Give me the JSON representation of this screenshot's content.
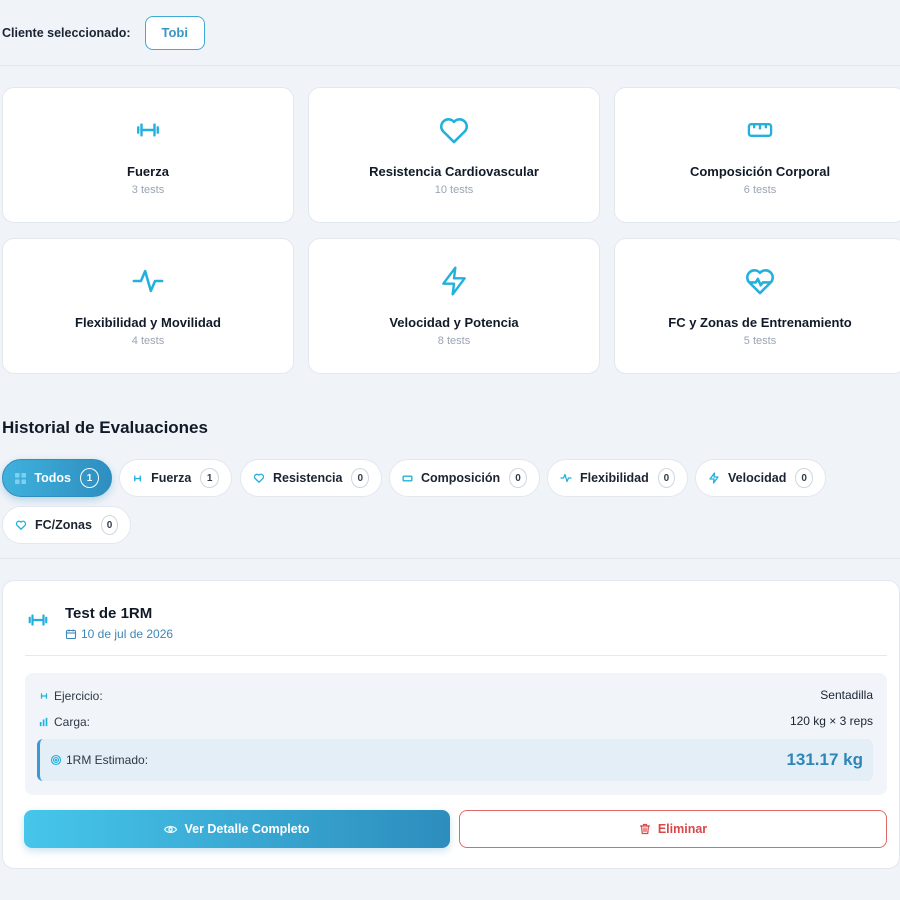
{
  "client": {
    "label": "Cliente seleccionado:",
    "name": "Tobi"
  },
  "categories": [
    {
      "icon": "dumbbell-icon",
      "title": "Fuerza",
      "count": "3 tests"
    },
    {
      "icon": "heart-icon",
      "title": "Resistencia Cardiovascular",
      "count": "10 tests"
    },
    {
      "icon": "ruler-icon",
      "title": "Composición Corporal",
      "count": "6 tests"
    },
    {
      "icon": "activity-icon",
      "title": "Flexibilidad y Movilidad",
      "count": "4 tests"
    },
    {
      "icon": "lightning-icon",
      "title": "Velocidad y Potencia",
      "count": "8 tests"
    },
    {
      "icon": "heart-pulse-icon",
      "title": "FC y Zonas de Entrenamiento",
      "count": "5 tests"
    }
  ],
  "history": {
    "title": "Historial de Evaluaciones",
    "filters": [
      {
        "label": "Todos",
        "count": "1",
        "active": true
      },
      {
        "label": "Fuerza",
        "count": "1"
      },
      {
        "label": "Resistencia",
        "count": "0"
      },
      {
        "label": "Composición",
        "count": "0"
      },
      {
        "label": "Flexibilidad",
        "count": "0"
      },
      {
        "label": "Velocidad",
        "count": "0"
      },
      {
        "label": "FC/Zonas",
        "count": "0"
      }
    ]
  },
  "evaluation": {
    "title": "Test de 1RM",
    "date": "10 de jul de 2026",
    "exercise_label": "Ejercicio:",
    "exercise_value": "Sentadilla",
    "load_label": "Carga:",
    "load_value": "120 kg × 3 reps",
    "rm_label": "1RM Estimado:",
    "rm_value": "131.17 kg",
    "detail_button": "Ver Detalle Completo",
    "delete_button": "Eliminar"
  },
  "colors": {
    "accent": "#2e9fd4",
    "danger": "#d94848"
  }
}
